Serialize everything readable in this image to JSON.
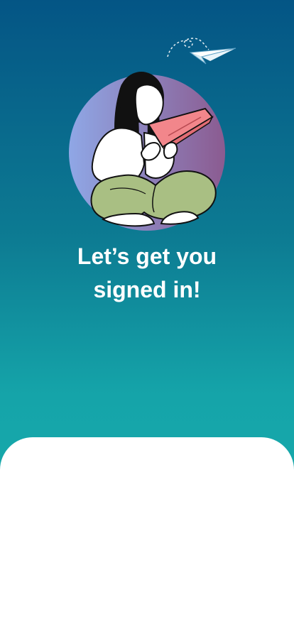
{
  "app": {
    "headline_line_1": "Let’s get you",
    "headline_line_2": "signed in!"
  },
  "illustration": {
    "name": "woman-reading-book",
    "background_gradient": [
      "#8fa7e6",
      "#8b5b90"
    ],
    "book_color": "#f2868b",
    "pants_color": "#a9bf83"
  },
  "decoration": {
    "plane_icon": "paper-plane-icon"
  },
  "colors": {
    "background_top": "#045585",
    "background_bottom": "#19b1ae",
    "text": "#ffffff",
    "card": "#ffffff"
  }
}
